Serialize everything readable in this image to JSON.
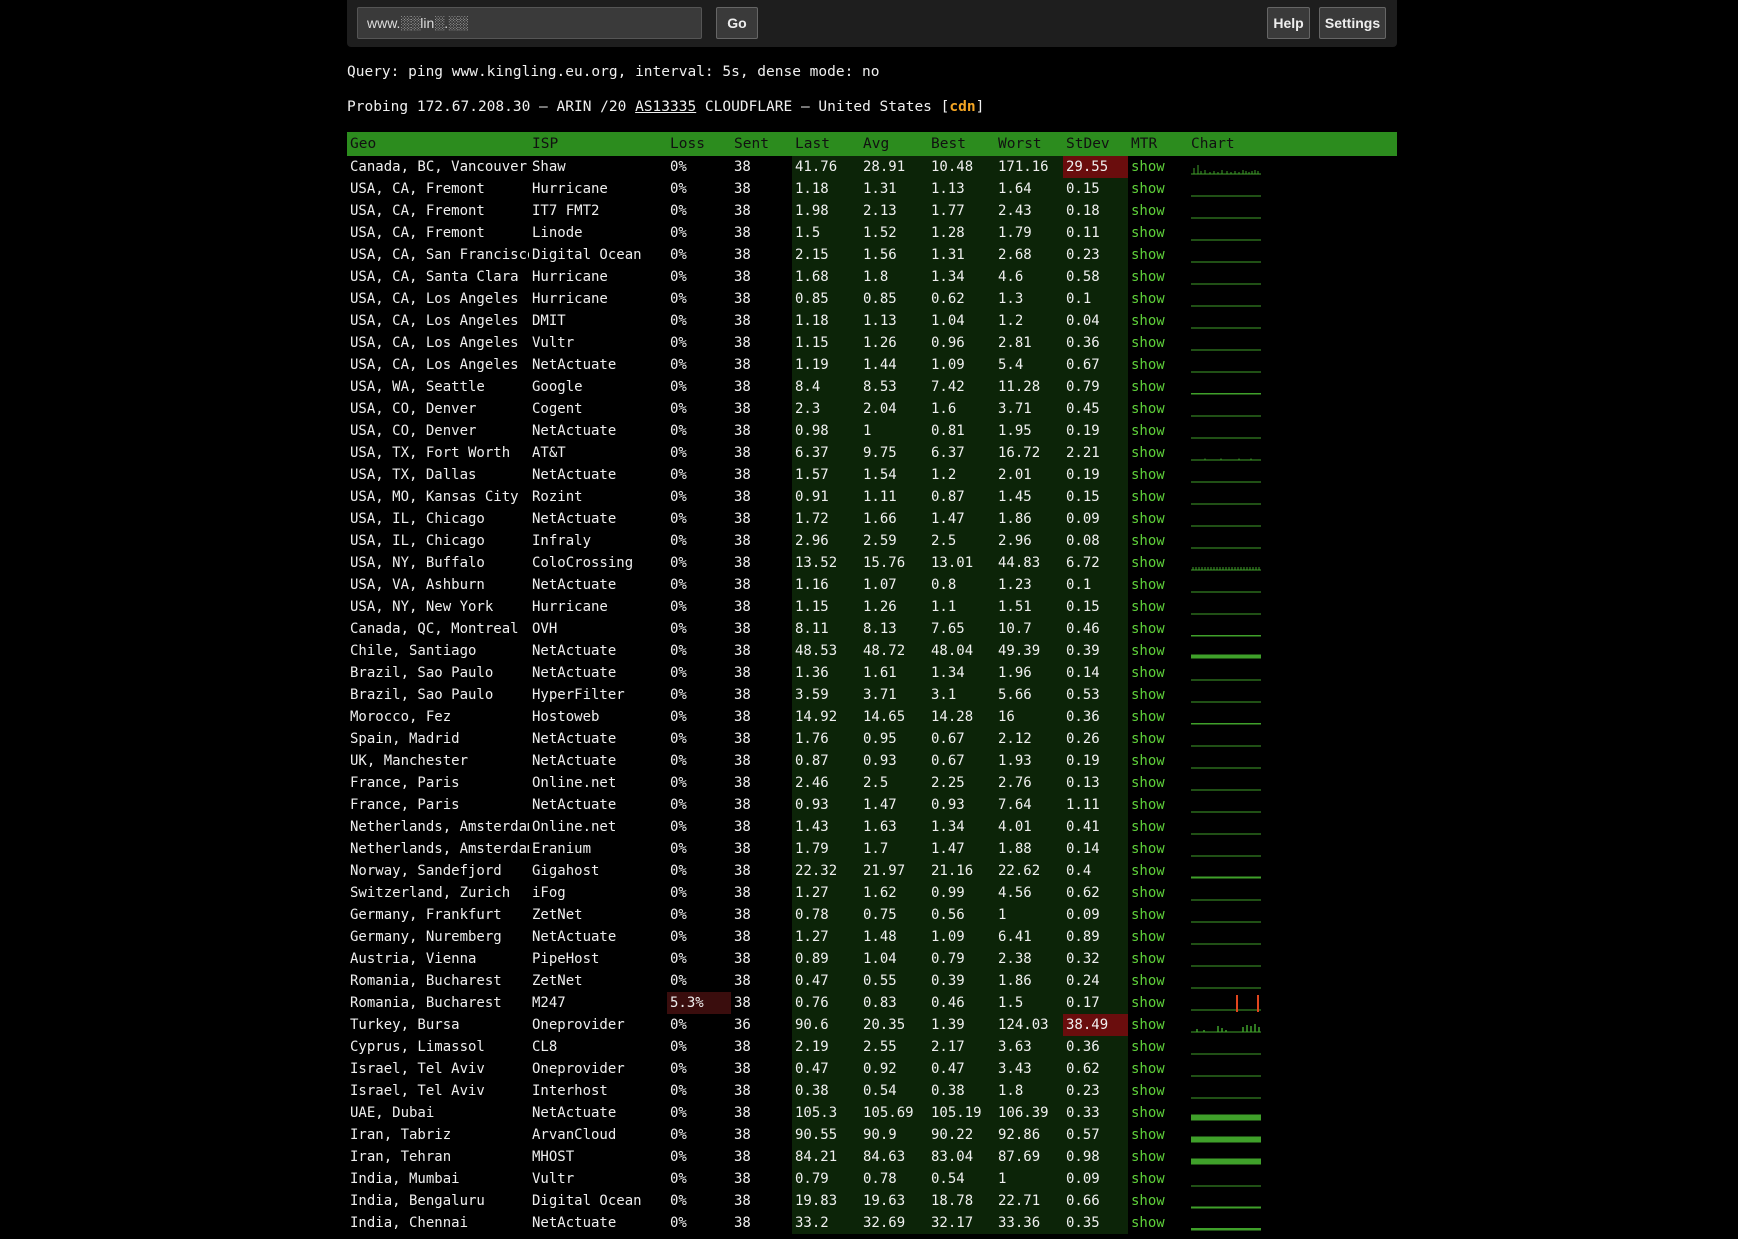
{
  "search": {
    "value": "www.░░lin░.░░",
    "placeholder": ""
  },
  "buttons": {
    "go": "Go",
    "help": "Help",
    "settings": "Settings"
  },
  "query_line": "Query: ping www.kingling.eu.org, interval: 5s, dense mode: no",
  "probe": {
    "prefix": "Probing 172.67.208.30 — ARIN /20 ",
    "asn": "AS13335",
    "suffix": " CLOUDFLARE — United States [",
    "tag": "cdn",
    "close": "]"
  },
  "colors": {
    "header_green": "#2c8c1e",
    "stat_bg": "#0c2408",
    "highlight_red": "#6a0d0d",
    "link_green": "#5fd13a",
    "chart_green": "#3fa02a",
    "cdn_orange": "#f5a623"
  },
  "columns": [
    "Geo",
    "ISP",
    "Loss",
    "Sent",
    "Last",
    "Avg",
    "Best",
    "Worst",
    "StDev",
    "MTR",
    "Chart"
  ],
  "rows": [
    {
      "geo": "Canada, BC, Vancouver",
      "isp": "Shaw",
      "loss": "0%",
      "sent": "38",
      "last": "41.76",
      "avg": "28.91",
      "best": "10.48",
      "worst": "171.16",
      "stdev": "29.55",
      "mtr": "show",
      "stdev_hi": true,
      "chart": "spiky"
    },
    {
      "geo": "USA, CA, Fremont",
      "isp": "Hurricane",
      "loss": "0%",
      "sent": "38",
      "last": "1.18",
      "avg": "1.31",
      "best": "1.13",
      "worst": "1.64",
      "stdev": "0.15",
      "mtr": "show",
      "chart": "flat"
    },
    {
      "geo": "USA, CA, Fremont",
      "isp": "IT7 FMT2",
      "loss": "0%",
      "sent": "38",
      "last": "1.98",
      "avg": "2.13",
      "best": "1.77",
      "worst": "2.43",
      "stdev": "0.18",
      "mtr": "show",
      "chart": "flat"
    },
    {
      "geo": "USA, CA, Fremont",
      "isp": "Linode",
      "loss": "0%",
      "sent": "38",
      "last": "1.5",
      "avg": "1.52",
      "best": "1.28",
      "worst": "1.79",
      "stdev": "0.11",
      "mtr": "show",
      "chart": "flat"
    },
    {
      "geo": "USA, CA, San Francisco",
      "isp": "Digital Ocean",
      "loss": "0%",
      "sent": "38",
      "last": "2.15",
      "avg": "1.56",
      "best": "1.31",
      "worst": "2.68",
      "stdev": "0.23",
      "mtr": "show",
      "chart": "flat"
    },
    {
      "geo": "USA, CA, Santa Clara",
      "isp": "Hurricane",
      "loss": "0%",
      "sent": "38",
      "last": "1.68",
      "avg": "1.8",
      "best": "1.34",
      "worst": "4.6",
      "stdev": "0.58",
      "mtr": "show",
      "chart": "flat"
    },
    {
      "geo": "USA, CA, Los Angeles",
      "isp": "Hurricane",
      "loss": "0%",
      "sent": "38",
      "last": "0.85",
      "avg": "0.85",
      "best": "0.62",
      "worst": "1.3",
      "stdev": "0.1",
      "mtr": "show",
      "chart": "flat"
    },
    {
      "geo": "USA, CA, Los Angeles",
      "isp": "DMIT",
      "loss": "0%",
      "sent": "38",
      "last": "1.18",
      "avg": "1.13",
      "best": "1.04",
      "worst": "1.2",
      "stdev": "0.04",
      "mtr": "show",
      "chart": "flat"
    },
    {
      "geo": "USA, CA, Los Angeles",
      "isp": "Vultr",
      "loss": "0%",
      "sent": "38",
      "last": "1.15",
      "avg": "1.26",
      "best": "0.96",
      "worst": "2.81",
      "stdev": "0.36",
      "mtr": "show",
      "chart": "flat"
    },
    {
      "geo": "USA, CA, Los Angeles",
      "isp": "NetActuate",
      "loss": "0%",
      "sent": "38",
      "last": "1.19",
      "avg": "1.44",
      "best": "1.09",
      "worst": "5.4",
      "stdev": "0.67",
      "mtr": "show",
      "chart": "flat"
    },
    {
      "geo": "USA, WA, Seattle",
      "isp": "Google",
      "loss": "0%",
      "sent": "38",
      "last": "8.4",
      "avg": "8.53",
      "best": "7.42",
      "worst": "11.28",
      "stdev": "0.79",
      "mtr": "show",
      "chart": "flat2"
    },
    {
      "geo": "USA, CO, Denver",
      "isp": "Cogent",
      "loss": "0%",
      "sent": "38",
      "last": "2.3",
      "avg": "2.04",
      "best": "1.6",
      "worst": "3.71",
      "stdev": "0.45",
      "mtr": "show",
      "chart": "flat"
    },
    {
      "geo": "USA, CO, Denver",
      "isp": "NetActuate",
      "loss": "0%",
      "sent": "38",
      "last": "0.98",
      "avg": "1",
      "best": "0.81",
      "worst": "1.95",
      "stdev": "0.19",
      "mtr": "show",
      "chart": "flat"
    },
    {
      "geo": "USA, TX, Fort Worth",
      "isp": "AT&T",
      "loss": "0%",
      "sent": "38",
      "last": "6.37",
      "avg": "9.75",
      "best": "6.37",
      "worst": "16.72",
      "stdev": "2.21",
      "mtr": "show",
      "chart": "dots"
    },
    {
      "geo": "USA, TX, Dallas",
      "isp": "NetActuate",
      "loss": "0%",
      "sent": "38",
      "last": "1.57",
      "avg": "1.54",
      "best": "1.2",
      "worst": "2.01",
      "stdev": "0.19",
      "mtr": "show",
      "chart": "flat"
    },
    {
      "geo": "USA, MO, Kansas City",
      "isp": "Rozint",
      "loss": "0%",
      "sent": "38",
      "last": "0.91",
      "avg": "1.11",
      "best": "0.87",
      "worst": "1.45",
      "stdev": "0.15",
      "mtr": "show",
      "chart": "flat"
    },
    {
      "geo": "USA, IL, Chicago",
      "isp": "NetActuate",
      "loss": "0%",
      "sent": "38",
      "last": "1.72",
      "avg": "1.66",
      "best": "1.47",
      "worst": "1.86",
      "stdev": "0.09",
      "mtr": "show",
      "chart": "flat"
    },
    {
      "geo": "USA, IL, Chicago",
      "isp": "Infraly",
      "loss": "0%",
      "sent": "38",
      "last": "2.96",
      "avg": "2.59",
      "best": "2.5",
      "worst": "2.96",
      "stdev": "0.08",
      "mtr": "show",
      "chart": "flat"
    },
    {
      "geo": "USA, NY, Buffalo",
      "isp": "ColoCrossing",
      "loss": "0%",
      "sent": "38",
      "last": "13.52",
      "avg": "15.76",
      "best": "13.01",
      "worst": "44.83",
      "stdev": "6.72",
      "mtr": "show",
      "chart": "noisy"
    },
    {
      "geo": "USA, VA, Ashburn",
      "isp": "NetActuate",
      "loss": "0%",
      "sent": "38",
      "last": "1.16",
      "avg": "1.07",
      "best": "0.8",
      "worst": "1.23",
      "stdev": "0.1",
      "mtr": "show",
      "chart": "flat"
    },
    {
      "geo": "USA, NY, New York",
      "isp": "Hurricane",
      "loss": "0%",
      "sent": "38",
      "last": "1.15",
      "avg": "1.26",
      "best": "1.1",
      "worst": "1.51",
      "stdev": "0.15",
      "mtr": "show",
      "chart": "flat"
    },
    {
      "geo": "Canada, QC, Montreal",
      "isp": "OVH",
      "loss": "0%",
      "sent": "38",
      "last": "8.11",
      "avg": "8.13",
      "best": "7.65",
      "worst": "10.7",
      "stdev": "0.46",
      "mtr": "show",
      "chart": "flat2"
    },
    {
      "geo": "Chile, Santiago",
      "isp": "NetActuate",
      "loss": "0%",
      "sent": "38",
      "last": "48.53",
      "avg": "48.72",
      "best": "48.04",
      "worst": "49.39",
      "stdev": "0.39",
      "mtr": "show",
      "chart": "thick"
    },
    {
      "geo": "Brazil, Sao Paulo",
      "isp": "NetActuate",
      "loss": "0%",
      "sent": "38",
      "last": "1.36",
      "avg": "1.61",
      "best": "1.34",
      "worst": "1.96",
      "stdev": "0.14",
      "mtr": "show",
      "chart": "flat"
    },
    {
      "geo": "Brazil, Sao Paulo",
      "isp": "HyperFilter",
      "loss": "0%",
      "sent": "38",
      "last": "3.59",
      "avg": "3.71",
      "best": "3.1",
      "worst": "5.66",
      "stdev": "0.53",
      "mtr": "show",
      "chart": "flat"
    },
    {
      "geo": "Morocco, Fez",
      "isp": "Hostoweb",
      "loss": "0%",
      "sent": "38",
      "last": "14.92",
      "avg": "14.65",
      "best": "14.28",
      "worst": "16",
      "stdev": "0.36",
      "mtr": "show",
      "chart": "flat2"
    },
    {
      "geo": "Spain, Madrid",
      "isp": "NetActuate",
      "loss": "0%",
      "sent": "38",
      "last": "1.76",
      "avg": "0.95",
      "best": "0.67",
      "worst": "2.12",
      "stdev": "0.26",
      "mtr": "show",
      "chart": "flat"
    },
    {
      "geo": "UK, Manchester",
      "isp": "NetActuate",
      "loss": "0%",
      "sent": "38",
      "last": "0.87",
      "avg": "0.93",
      "best": "0.67",
      "worst": "1.93",
      "stdev": "0.19",
      "mtr": "show",
      "chart": "flat"
    },
    {
      "geo": "France, Paris",
      "isp": "Online.net",
      "loss": "0%",
      "sent": "38",
      "last": "2.46",
      "avg": "2.5",
      "best": "2.25",
      "worst": "2.76",
      "stdev": "0.13",
      "mtr": "show",
      "chart": "flat"
    },
    {
      "geo": "France, Paris",
      "isp": "NetActuate",
      "loss": "0%",
      "sent": "38",
      "last": "0.93",
      "avg": "1.47",
      "best": "0.93",
      "worst": "7.64",
      "stdev": "1.11",
      "mtr": "show",
      "chart": "flat"
    },
    {
      "geo": "Netherlands, Amsterdam",
      "isp": "Online.net",
      "loss": "0%",
      "sent": "38",
      "last": "1.43",
      "avg": "1.63",
      "best": "1.34",
      "worst": "4.01",
      "stdev": "0.41",
      "mtr": "show",
      "chart": "flat"
    },
    {
      "geo": "Netherlands, Amsterdam",
      "isp": "Eranium",
      "loss": "0%",
      "sent": "38",
      "last": "1.79",
      "avg": "1.7",
      "best": "1.47",
      "worst": "1.88",
      "stdev": "0.14",
      "mtr": "show",
      "chart": "flat"
    },
    {
      "geo": "Norway, Sandefjord",
      "isp": "Gigahost",
      "loss": "0%",
      "sent": "38",
      "last": "22.32",
      "avg": "21.97",
      "best": "21.16",
      "worst": "22.62",
      "stdev": "0.4",
      "mtr": "show",
      "chart": "mid"
    },
    {
      "geo": "Switzerland, Zurich",
      "isp": "iFog",
      "loss": "0%",
      "sent": "38",
      "last": "1.27",
      "avg": "1.62",
      "best": "0.99",
      "worst": "4.56",
      "stdev": "0.62",
      "mtr": "show",
      "chart": "flat"
    },
    {
      "geo": "Germany, Frankfurt",
      "isp": "ZetNet",
      "loss": "0%",
      "sent": "38",
      "last": "0.78",
      "avg": "0.75",
      "best": "0.56",
      "worst": "1",
      "stdev": "0.09",
      "mtr": "show",
      "chart": "flat"
    },
    {
      "geo": "Germany, Nuremberg",
      "isp": "NetActuate",
      "loss": "0%",
      "sent": "38",
      "last": "1.27",
      "avg": "1.48",
      "best": "1.09",
      "worst": "6.41",
      "stdev": "0.89",
      "mtr": "show",
      "chart": "flat"
    },
    {
      "geo": "Austria, Vienna",
      "isp": "PipeHost",
      "loss": "0%",
      "sent": "38",
      "last": "0.89",
      "avg": "1.04",
      "best": "0.79",
      "worst": "2.38",
      "stdev": "0.32",
      "mtr": "show",
      "chart": "flat"
    },
    {
      "geo": "Romania, Bucharest",
      "isp": "ZetNet",
      "loss": "0%",
      "sent": "38",
      "last": "0.47",
      "avg": "0.55",
      "best": "0.39",
      "worst": "1.86",
      "stdev": "0.24",
      "mtr": "show",
      "chart": "flat"
    },
    {
      "geo": "Romania, Bucharest",
      "isp": "M247",
      "loss": "5.3%",
      "sent": "38",
      "last": "0.76",
      "avg": "0.83",
      "best": "0.46",
      "worst": "1.5",
      "stdev": "0.17",
      "mtr": "show",
      "loss_hi": true,
      "chart": "loss"
    },
    {
      "geo": "Turkey, Bursa",
      "isp": "Oneprovider",
      "loss": "0%",
      "sent": "36",
      "last": "90.6",
      "avg": "20.35",
      "best": "1.39",
      "worst": "124.03",
      "stdev": "38.49",
      "mtr": "show",
      "stdev_hi": true,
      "chart": "bars"
    },
    {
      "geo": "Cyprus, Limassol",
      "isp": "CL8",
      "loss": "0%",
      "sent": "38",
      "last": "2.19",
      "avg": "2.55",
      "best": "2.17",
      "worst": "3.63",
      "stdev": "0.36",
      "mtr": "show",
      "chart": "flat"
    },
    {
      "geo": "Israel, Tel Aviv",
      "isp": "Oneprovider",
      "loss": "0%",
      "sent": "38",
      "last": "0.47",
      "avg": "0.92",
      "best": "0.47",
      "worst": "3.43",
      "stdev": "0.62",
      "mtr": "show",
      "chart": "flat"
    },
    {
      "geo": "Israel, Tel Aviv",
      "isp": "Interhost",
      "loss": "0%",
      "sent": "38",
      "last": "0.38",
      "avg": "0.54",
      "best": "0.38",
      "worst": "1.8",
      "stdev": "0.23",
      "mtr": "show",
      "chart": "flat"
    },
    {
      "geo": "UAE, Dubai",
      "isp": "NetActuate",
      "loss": "0%",
      "sent": "38",
      "last": "105.3",
      "avg": "105.69",
      "best": "105.19",
      "worst": "106.39",
      "stdev": "0.33",
      "mtr": "show",
      "chart": "block"
    },
    {
      "geo": "Iran, Tabriz",
      "isp": "ArvanCloud",
      "loss": "0%",
      "sent": "38",
      "last": "90.55",
      "avg": "90.9",
      "best": "90.22",
      "worst": "92.86",
      "stdev": "0.57",
      "mtr": "show",
      "chart": "block"
    },
    {
      "geo": "Iran, Tehran",
      "isp": "MHOST",
      "loss": "0%",
      "sent": "38",
      "last": "84.21",
      "avg": "84.63",
      "best": "83.04",
      "worst": "87.69",
      "stdev": "0.98",
      "mtr": "show",
      "chart": "block"
    },
    {
      "geo": "India, Mumbai",
      "isp": "Vultr",
      "loss": "0%",
      "sent": "38",
      "last": "0.79",
      "avg": "0.78",
      "best": "0.54",
      "worst": "1",
      "stdev": "0.09",
      "mtr": "show",
      "chart": "flat"
    },
    {
      "geo": "India, Bengaluru",
      "isp": "Digital Ocean",
      "loss": "0%",
      "sent": "38",
      "last": "19.83",
      "avg": "19.63",
      "best": "18.78",
      "worst": "22.71",
      "stdev": "0.66",
      "mtr": "show",
      "chart": "mid"
    },
    {
      "geo": "India, Chennai",
      "isp": "NetActuate",
      "loss": "0%",
      "sent": "38",
      "last": "33.2",
      "avg": "32.69",
      "best": "32.17",
      "worst": "33.36",
      "stdev": "0.35",
      "mtr": "show",
      "chart": "mid2"
    }
  ]
}
